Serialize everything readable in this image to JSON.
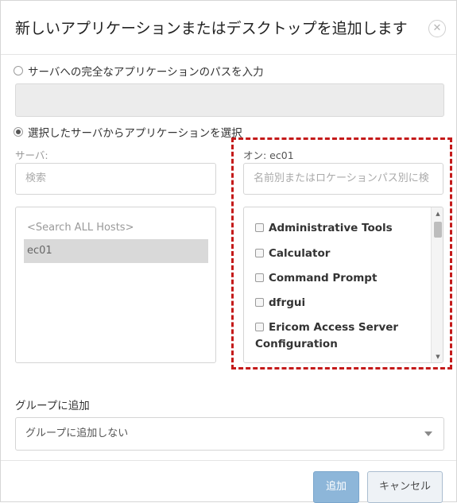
{
  "dialog": {
    "title": "新しいアプリケーションまたはデスクトップを追加します",
    "close_symbol": "✕"
  },
  "option_full_path": {
    "label": "サーバへの完全なアプリケーションのパスを入力",
    "selected": false,
    "input_value": ""
  },
  "option_select_from_server": {
    "label": "選択したサーバからアプリケーションを選択",
    "selected": true
  },
  "servers": {
    "label": "サーバ:",
    "search_placeholder": "検索",
    "items": [
      "<Search ALL Hosts>",
      "ec01"
    ],
    "selected_item": "ec01"
  },
  "applications": {
    "label": "オン: ec01",
    "search_placeholder": "名前別またはロケーションパス別に検",
    "items": [
      "Administrative Tools",
      "Calculator",
      "Command Prompt",
      "dfrgui",
      "Ericom Access Server Configuration"
    ],
    "highlight_color": "#c41a1a"
  },
  "group": {
    "label": "グループに追加",
    "selected_value": "グループに追加しない"
  },
  "footer": {
    "add_label": "追加",
    "cancel_label": "キャンセル"
  },
  "icons": {
    "close": "close-icon",
    "dropdown": "chevron-down-icon",
    "scroll_up": "scroll-up-icon",
    "scroll_down": "scroll-down-icon"
  }
}
